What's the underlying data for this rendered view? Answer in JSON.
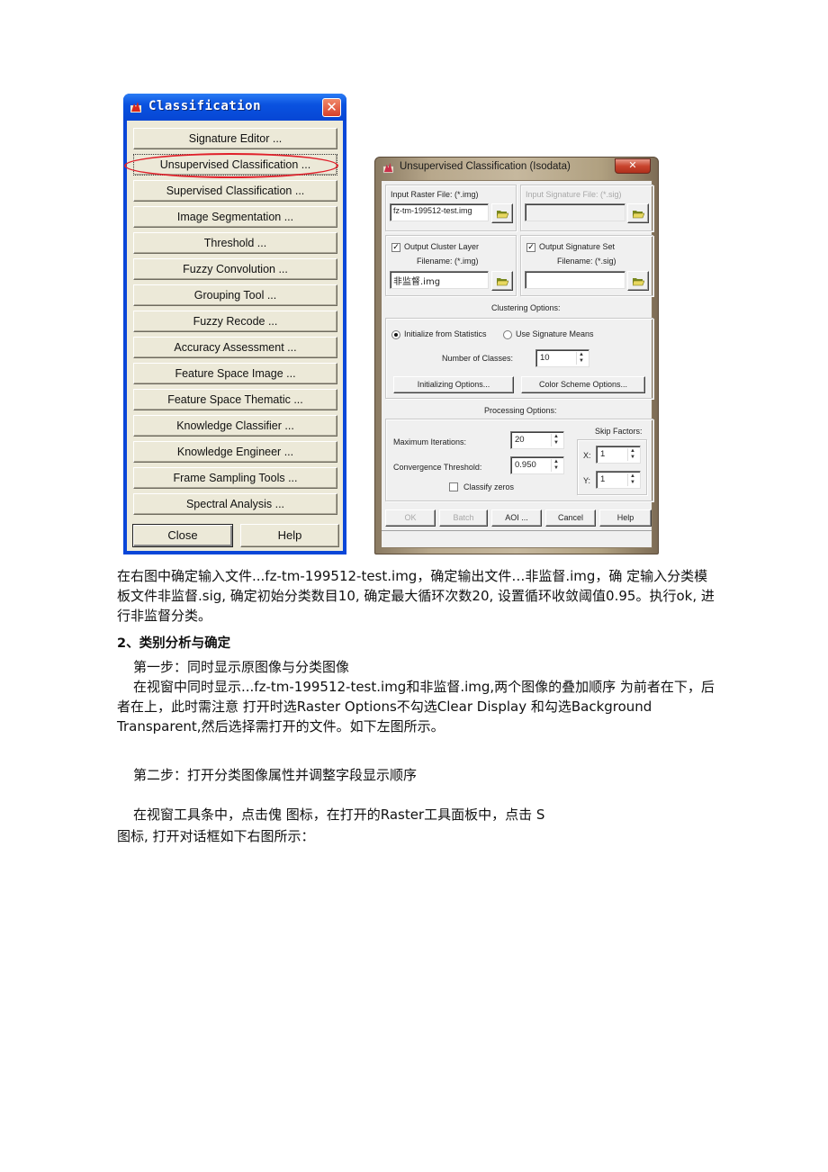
{
  "classification_window": {
    "title": "Classification",
    "icon": "erdas-app-icon",
    "close_icon": "close-icon",
    "menu_buttons": [
      {
        "label": "Signature Editor ..."
      },
      {
        "label": "Unsupervised Classification ...",
        "highlighted": true,
        "highlight_color": "#e0202a"
      },
      {
        "label": "Supervised Classification ..."
      },
      {
        "label": "Image Segmentation ..."
      },
      {
        "label": "Threshold ..."
      },
      {
        "label": "Fuzzy Convolution ..."
      },
      {
        "label": "Grouping Tool ..."
      },
      {
        "label": "Fuzzy Recode ..."
      },
      {
        "label": "Accuracy Assessment ..."
      },
      {
        "label": "Feature Space Image ..."
      },
      {
        "label": "Feature Space Thematic ..."
      },
      {
        "label": "Knowledge Classifier ..."
      },
      {
        "label": "Knowledge Engineer ..."
      },
      {
        "label": "Frame Sampling Tools ..."
      },
      {
        "label": "Spectral Analysis ..."
      }
    ],
    "close_label": "Close",
    "help_label": "Help"
  },
  "isodata_dialog": {
    "title": "Unsupervised Classification (Isodata)",
    "close_icon": "close-icon",
    "input_raster_label": "Input Raster File: (*.img)",
    "input_raster_value": "fz-tm-199512-test.img",
    "input_signature_label": "Input Signature File: (*.sig)",
    "input_signature_value": "",
    "output_cluster_label": "Output Cluster Layer",
    "output_cluster_checked": true,
    "output_cluster_filename_label": "Filename: (*.img)",
    "output_cluster_value": "非监督.img",
    "output_signature_label": "Output Signature Set",
    "output_signature_checked": true,
    "output_signature_filename_label": "Filename: (*.sig)",
    "output_signature_value": "",
    "clustering_options_label": "Clustering Options:",
    "init_from_stats_label": "Initialize from Statistics",
    "use_sig_means_label": "Use Signature Means",
    "selected_init": "Initialize from Statistics",
    "num_classes_label": "Number of Classes:",
    "num_classes_value": "10",
    "initializing_options_label": "Initializing Options...",
    "color_scheme_options_label": "Color Scheme Options...",
    "processing_options_label": "Processing Options:",
    "max_iterations_label": "Maximum Iterations:",
    "max_iterations_value": "20",
    "convergence_label": "Convergence Threshold:",
    "convergence_value": "0.950",
    "classify_zeros_label": "Classify zeros",
    "classify_zeros_checked": false,
    "skip_factors_label": "Skip Factors:",
    "skip_x_label": "X:",
    "skip_x_value": "1",
    "skip_y_label": "Y:",
    "skip_y_value": "1",
    "buttons": {
      "ok": "OK",
      "batch": "Batch",
      "aoi": "AOI ...",
      "cancel": "Cancel",
      "help": "Help"
    }
  },
  "document": {
    "para1": "在右图中确定输入文件...fz-tm-199512-test.img，确定输出文件…非监督.img，确 定输入分类模板文件非监督.sig, 确定初始分类数目10, 确定最大循环次数20, 设置循环收敛阈值0.95。执行ok, 进行非监督分类。",
    "heading2": "2、类别分析与确定",
    "step1_title": "第一步：同时显示原图像与分类图像",
    "step1_body": "在视窗中同时显示...fz-tm-199512-test.img和非监督.img,两个图像的叠加顺序 为前者在下，后者在上，此时需注意 打开时选Raster Options不勾选Clear Display 和勾选Background Transparent,然后选择需打开的文件。如下左图所示。",
    "step2_title": "第二步：打开分类图像属性并调整字段显示顺序",
    "step2_body": "在视窗工具条中，点击傀 图标，在打开的Raster工具面板中，点击 S",
    "step2_body_cont": "图标, 打开对话框如下右图所示："
  }
}
